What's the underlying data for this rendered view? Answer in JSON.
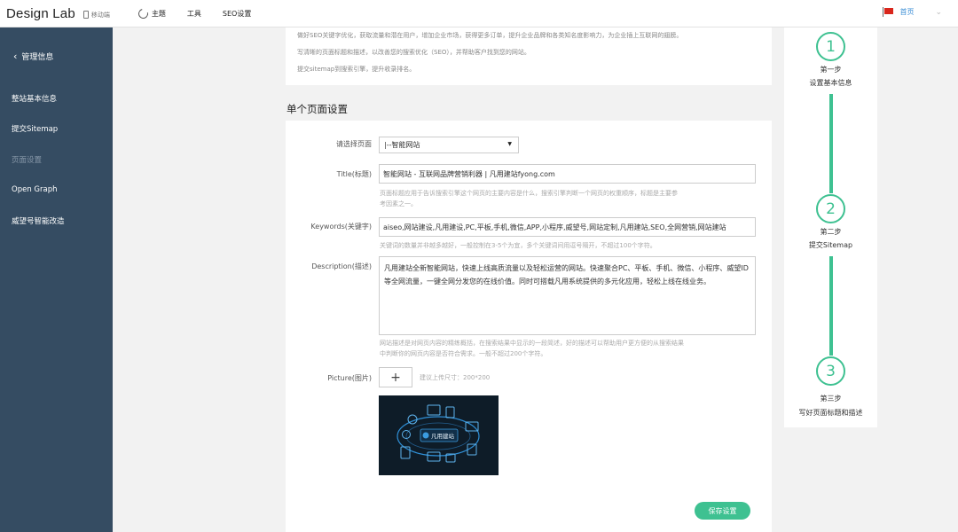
{
  "header": {
    "logo": "Design Lab",
    "mobile_label": "移动端",
    "nav": [
      {
        "label": "主题"
      },
      {
        "label": "工具"
      },
      {
        "label": "SEO设置"
      }
    ],
    "home_label": "首页"
  },
  "sidebar": {
    "back_label": "管理信息",
    "items": [
      {
        "label": "整站基本信息"
      },
      {
        "label": "提交Sitemap"
      },
      {
        "label": "页面设置"
      },
      {
        "label": "Open Graph"
      },
      {
        "label": "威望号智能改造"
      }
    ]
  },
  "intro": {
    "lines": [
      "做好SEO关键字优化，获取流量和潜在用户，增加企业市场，获得更多订单，提升企业品牌和各类知名度影响力，为企业插上互联网的翅膀。",
      "写清晰的页面标题和描述，以改善您的搜索优化（SEO），并帮助客户找到您的网站。",
      "提交sitemap到搜索引擎，提升收录排名。"
    ]
  },
  "page_settings": {
    "section_title": "单个页面设置",
    "select_label": "请选择页面",
    "select_value": "|--智能网站",
    "title_label": "Title(标题)",
    "title_value": "智能网站 - 互联网品牌营销利器 | 凡用建站fyong.com",
    "title_hint": [
      "页面标题应用于告诉搜索引擎这个网页的主要内容是什么，搜索引擎判断一个网页的权重顺序，标题是主要参",
      "考因素之一。"
    ],
    "keywords_label": "Keywords(关键字)",
    "keywords_value": "aiseo,网站建设,凡用建设,PC,平板,手机,微信,APP,小程序,威望号,网站定制,凡用建站,SEO,全网营销,网站建站",
    "keywords_hint": "关键词的数量并非越多越好，一般控制在3-5个为宜，多个关键词间用逗号隔开，不超过100个字符。",
    "description_label": "Description(描述)",
    "description_value": "凡用建站全新智能网站，快速上线高质流量以及轻松运营的网站。快速聚合PC、平板、手机、微信、小程序、威望ID等全网流量，一键全网分发您的在线价值。同时可搭载凡用系统提供的多元化应用，轻松上线在线业务。",
    "description_hint": [
      "网站描述是对网页内容的精练概括，在搜索结果中显示的一段简述，好的描述可以帮助用户更方便的从搜索结果",
      "中判断你的网页内容是否符合需求。一般不超过200个字符。"
    ],
    "picture_label": "Picture(图片)",
    "picture_add": "+",
    "picture_hint": "建议上传尺寸：200*200",
    "preview_logo_text": "凡用建站",
    "save_label": "保存设置"
  },
  "steps": [
    {
      "number": "1",
      "label": "第一步",
      "title": "设置基本信息"
    },
    {
      "number": "2",
      "label": "第二步",
      "title": "提交Sitemap"
    },
    {
      "number": "3",
      "label": "第三步",
      "title": "写好页面标题和描述"
    }
  ],
  "colors": {
    "accent": "#3ec191",
    "sidebar_bg": "#354c62",
    "link": "#3d8fd6"
  }
}
